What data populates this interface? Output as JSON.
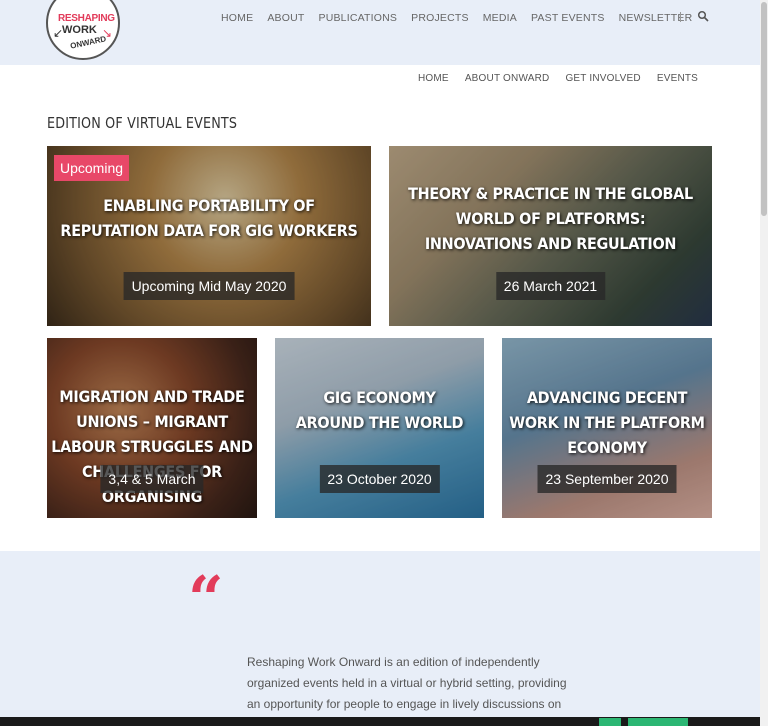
{
  "logo": {
    "line1": "RESHAPING",
    "line2": "WORK",
    "line3": "ONWARD"
  },
  "main_nav": [
    "HOME",
    "ABOUT",
    "PUBLICATIONS",
    "PROJECTS",
    "MEDIA",
    "PAST EVENTS",
    "NEWSLETTER"
  ],
  "sub_nav": [
    "HOME",
    "ABOUT ONWARD",
    "GET INVOLVED",
    "EVENTS"
  ],
  "section_title": "EDITION OF VIRTUAL EVENTS",
  "cards": [
    {
      "badge": "Upcoming",
      "title": "ENABLING PORTABILITY OF REPUTATION DATA FOR GIG WORKERS",
      "date": "Upcoming Mid May 2020"
    },
    {
      "title": "THEORY & PRACTICE IN THE GLOBAL WORLD OF PLATFORMS: INNOVATIONS AND REGULATION",
      "date": "26 March 2021"
    },
    {
      "title": "MIGRATION AND TRADE UNIONS – MIGRANT LABOUR STRUGGLES AND CHALLENGES FOR ORGANISING",
      "date": "3,4 & 5 March"
    },
    {
      "title": "GIG ECONOMY AROUND THE WORLD",
      "date": "23 October 2020"
    },
    {
      "title": "ADVANCING DECENT WORK IN THE PLATFORM ECONOMY",
      "date": "23 September 2020"
    }
  ],
  "quote_mark": "“",
  "about_text": "Reshaping Work Onward is an edition of independently organized events held in a virtual or hybrid setting, providing an opportunity for people to engage in lively discussions on",
  "colors": {
    "accent": "#e23b5a",
    "header_bg": "#e8eef8",
    "cookie_button": "#2bb673"
  }
}
